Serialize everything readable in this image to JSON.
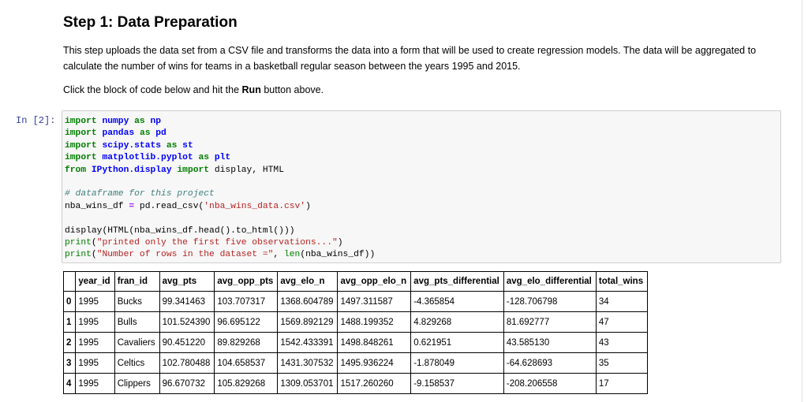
{
  "markdown": {
    "heading": "Step 1: Data Preparation",
    "para1": "This step uploads the data set from a CSV file and transforms the data into a form that will be used to create regression models. The data will be aggregated to calculate the number of wins for teams in a basketball regular season between the years 1995 and 2015.",
    "para2_prefix": "Click the block of code below and hit the ",
    "para2_bold": "Run",
    "para2_suffix": " button above."
  },
  "cell": {
    "prompt": "In [2]:",
    "code": {
      "l1_kw": "import",
      "l1_mod": "numpy",
      "l1_as": "as",
      "l1_alias": "np",
      "l2_kw": "import",
      "l2_mod": "pandas",
      "l2_as": "as",
      "l2_alias": "pd",
      "l3_kw": "import",
      "l3_mod": "scipy.stats",
      "l3_as": "as",
      "l3_alias": "st",
      "l4_kw": "import",
      "l4_mod": "matplotlib.pyplot",
      "l4_as": "as",
      "l4_alias": "plt",
      "l5_from": "from",
      "l5_mod": "IPython.display",
      "l5_import": "import",
      "l5_rest": "display, HTML",
      "l7_comment": "# dataframe for this project",
      "l8_a": "nba_wins_df ",
      "l8_eq": "=",
      "l8_b": " pd.read_csv(",
      "l8_str": "'nba_wins_data.csv'",
      "l8_c": ")",
      "l10_a": "display(HTML(nba_wins_df.head().to_html()))",
      "l11_fn": "print",
      "l11_a": "(",
      "l11_str": "\"printed only the first five observations...\"",
      "l11_b": ")",
      "l12_fn": "print",
      "l12_a": "(",
      "l12_str": "\"Number of rows in the dataset =\"",
      "l12_b": ", ",
      "l12_fn2": "len",
      "l12_c": "(nba_wins_df))"
    }
  },
  "table": {
    "columns": [
      "",
      "year_id",
      "fran_id",
      "avg_pts",
      "avg_opp_pts",
      "avg_elo_n",
      "avg_opp_elo_n",
      "avg_pts_differential",
      "avg_elo_differential",
      "total_wins"
    ],
    "rows": [
      [
        "0",
        "1995",
        "Bucks",
        "99.341463",
        "103.707317",
        "1368.604789",
        "1497.311587",
        "-4.365854",
        "-128.706798",
        "34"
      ],
      [
        "1",
        "1995",
        "Bulls",
        "101.524390",
        "96.695122",
        "1569.892129",
        "1488.199352",
        "4.829268",
        "81.692777",
        "47"
      ],
      [
        "2",
        "1995",
        "Cavaliers",
        "90.451220",
        "89.829268",
        "1542.433391",
        "1498.848261",
        "0.621951",
        "43.585130",
        "43"
      ],
      [
        "3",
        "1995",
        "Celtics",
        "102.780488",
        "104.658537",
        "1431.307532",
        "1495.936224",
        "-1.878049",
        "-64.628693",
        "35"
      ],
      [
        "4",
        "1995",
        "Clippers",
        "96.670732",
        "105.829268",
        "1309.053701",
        "1517.260260",
        "-9.158537",
        "-208.206558",
        "17"
      ]
    ]
  }
}
